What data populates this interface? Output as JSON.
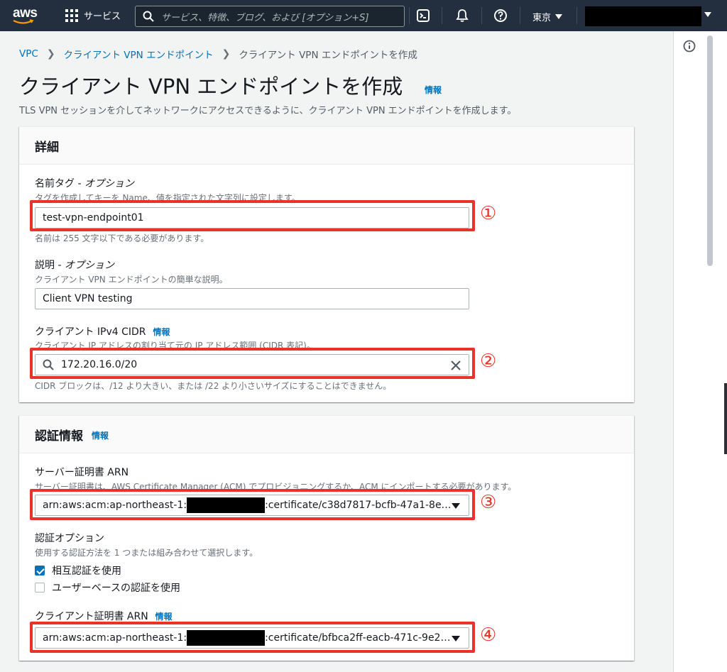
{
  "nav": {
    "logo_text": "aws",
    "services_label": "サービス",
    "search_placeholder": "サービス、特徴、ブログ、および [オプション+S]",
    "region_label": "東京"
  },
  "breadcrumb": {
    "items": [
      "VPC",
      "クライアント VPN エンドポイント",
      "クライアント VPN エンドポイントを作成"
    ]
  },
  "page": {
    "title": "クライアント VPN エンドポイントを作成",
    "info_label": "情報",
    "description": "TLS VPN セッションを介してネットワークにアクセスできるように、クライアント VPN エンドポイントを作成します。"
  },
  "details": {
    "title": "詳細",
    "name_tag_label": "名前タグ - ",
    "name_tag_optional": "オプション",
    "name_tag_hint": "タグを作成してキーを Name、値を指定された文字列に設定します。",
    "name_tag_value": "test-vpn-endpoint01",
    "name_tag_constraint": "名前は 255 文字以下である必要があります。",
    "description_label": "説明 - ",
    "description_optional": "オプション",
    "description_hint": "クライアント VPN エンドポイントの簡単な説明。",
    "description_value": "Client VPN testing",
    "cidr_label": "クライアント IPv4 CIDR",
    "cidr_info": "情報",
    "cidr_hint": "クライアント IP アドレスの割り当て元の IP アドレス範囲 (CIDR 表記)。",
    "cidr_value": "172.20.16.0/20",
    "cidr_constraint": "CIDR ブロックは、/12 より大きい、または /22 より小さいサイズにすることはできません。"
  },
  "auth": {
    "title": "認証情報",
    "info_label": "情報",
    "server_cert_label": "サーバー証明書 ARN",
    "server_cert_hint": "サーバー証明書は、AWS Certificate Manager (ACM) でプロビジョニングするか、ACM にインポートする必要があります。",
    "server_cert_prefix": "arn:aws:acm:ap-northeast-1:",
    "server_cert_suffix": ":certificate/c38d7817-bcfb-47a1-8e…",
    "auth_options_label": "認証オプション",
    "auth_options_hint": "使用する認証方法を 1 つまたは組み合わせて選択します。",
    "mutual_auth_label": "相互認証を使用",
    "mutual_auth_checked": true,
    "user_auth_label": "ユーザーベースの認証を使用",
    "user_auth_checked": false,
    "client_cert_label": "クライアント証明書 ARN",
    "client_cert_info": "情報",
    "client_cert_prefix": "arn:aws:acm:ap-northeast-1:",
    "client_cert_suffix": ":certificate/bfbca2ff-eacb-471c-9e2…"
  },
  "annotations": [
    "①",
    "②",
    "③",
    "④"
  ],
  "colors": {
    "highlight": "#e8332a",
    "link": "#0073bb",
    "nav_bg": "#232f3e"
  }
}
